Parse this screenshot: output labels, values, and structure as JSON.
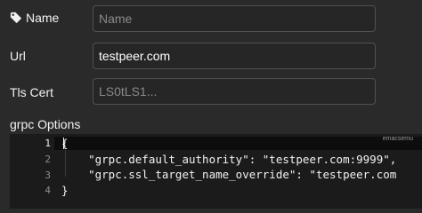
{
  "form": {
    "name": {
      "label": "Name",
      "value": "",
      "placeholder": "Name"
    },
    "url": {
      "label": "Url",
      "value": "testpeer.com",
      "placeholder": ""
    },
    "tls_cert": {
      "label": "Tls Cert",
      "value": "",
      "placeholder": "LS0tLS1..."
    },
    "grpc_options": {
      "label": "grpc Options"
    }
  },
  "editor": {
    "badge": "emacsemu",
    "line_numbers": [
      "1",
      "2",
      "3",
      "4"
    ],
    "lines": [
      "{",
      "    \"grpc.default_authority\": \"testpeer.com:9999\",",
      "    \"grpc.ssl_target_name_override\": \"testpeer.com",
      "}"
    ]
  },
  "icons": {
    "name_label_icon": "tag-icon"
  },
  "colors": {
    "background": "#2a2a2a",
    "editor_background": "#1b1b1b",
    "field_border": "#505050"
  }
}
